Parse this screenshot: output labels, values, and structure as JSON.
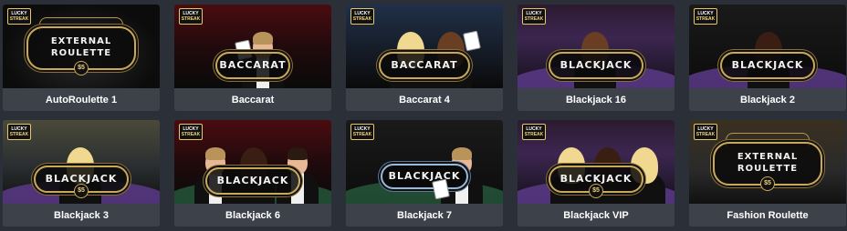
{
  "badge": {
    "line1": "LUCKY",
    "line2": "STREAK"
  },
  "games": [
    {
      "label": "AutoRoulette 1",
      "logo_line1": "EXTERNAL",
      "logo_line2": "ROULETTE",
      "logo_amount": "$5"
    },
    {
      "label": "Baccarat",
      "logo_text": "BACCARAT"
    },
    {
      "label": "Baccarat 4",
      "logo_text": "BACCARAT"
    },
    {
      "label": "Blackjack 16",
      "logo_text": "BLACKJACK"
    },
    {
      "label": "Blackjack 2",
      "logo_text": "BLACKJACK"
    },
    {
      "label": "Blackjack 3",
      "logo_text": "BLACKJACK",
      "logo_amount": "$5"
    },
    {
      "label": "Blackjack 6",
      "logo_text": "BLACKJACK"
    },
    {
      "label": "Blackjack 7",
      "logo_text": "BLACKJACK"
    },
    {
      "label": "Blackjack VIP",
      "logo_text": "BLACKJACK",
      "logo_amount": "$5"
    },
    {
      "label": "Fashion Roulette",
      "logo_line1": "EXTERNAL",
      "logo_line2": "ROULETTE",
      "logo_amount": "$5"
    }
  ]
}
